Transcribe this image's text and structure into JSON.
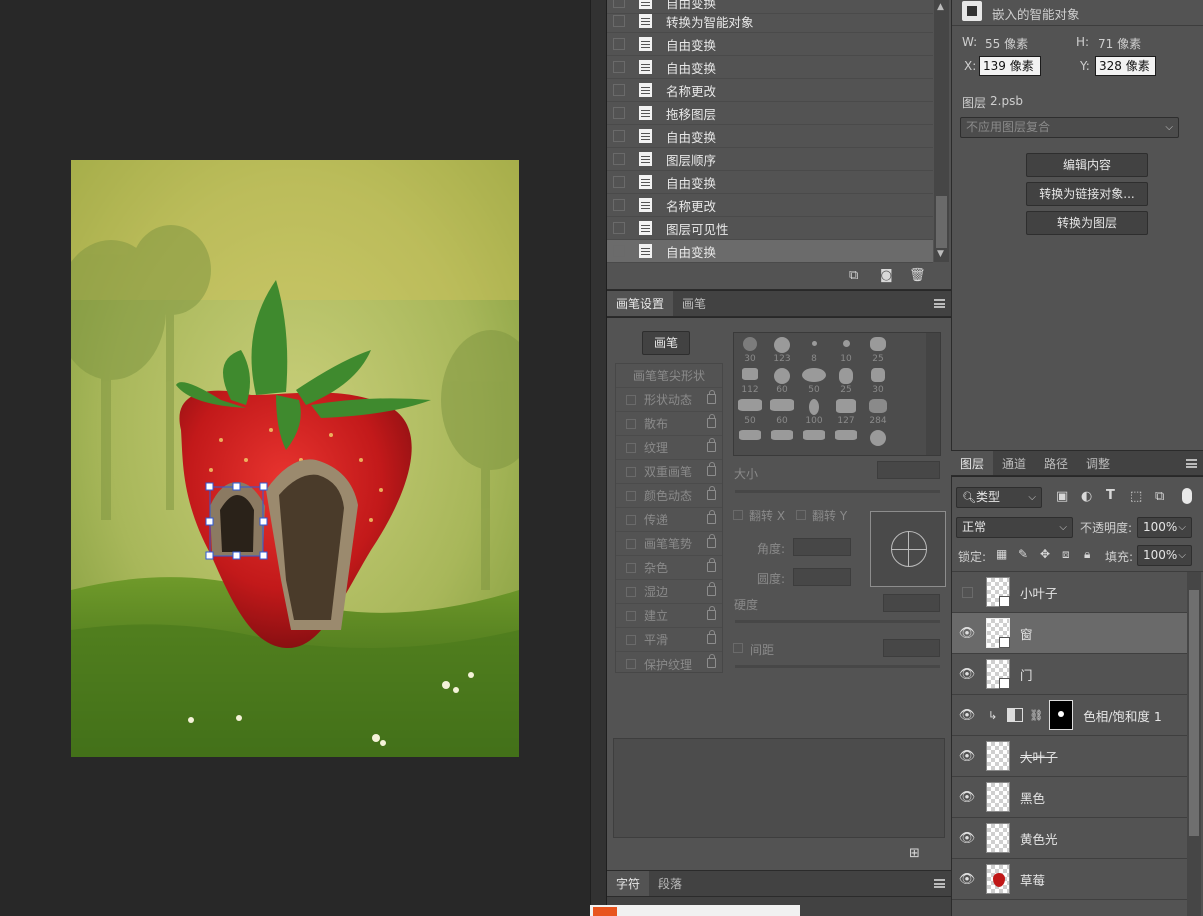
{
  "history": {
    "items": [
      {
        "label": "自由变换"
      },
      {
        "label": "转换为智能对象"
      },
      {
        "label": "自由变换"
      },
      {
        "label": "自由变换"
      },
      {
        "label": "名称更改"
      },
      {
        "label": "拖移图层"
      },
      {
        "label": "自由变换"
      },
      {
        "label": "图层顺序"
      },
      {
        "label": "自由变换"
      },
      {
        "label": "名称更改"
      },
      {
        "label": "图层可见性"
      },
      {
        "label": "自由变换"
      }
    ],
    "selected_index": 11,
    "footer_icons": [
      "new-snapshot-icon",
      "camera-icon",
      "trash-icon"
    ]
  },
  "brush_panel": {
    "tabs": [
      {
        "label": "画笔设置"
      },
      {
        "label": "画笔"
      }
    ],
    "brush_button": "画笔",
    "tip_shape_header": "画笔笔尖形状",
    "options": [
      {
        "label": "形状动态"
      },
      {
        "label": "散布"
      },
      {
        "label": "纹理"
      },
      {
        "label": "双重画笔"
      },
      {
        "label": "颜色动态"
      },
      {
        "label": "传递"
      },
      {
        "label": "画笔笔势"
      },
      {
        "label": "杂色"
      },
      {
        "label": "湿边"
      },
      {
        "label": "建立"
      },
      {
        "label": "平滑"
      },
      {
        "label": "保护纹理"
      }
    ],
    "tip_sizes": [
      "30",
      "123",
      "8",
      "10",
      "25",
      "112",
      "60",
      "50",
      "25",
      "30",
      "50",
      "60",
      "100",
      "127",
      "284",
      "",
      "",
      "",
      "",
      ""
    ],
    "size_label": "大小",
    "flip_x": "翻转 X",
    "flip_y": "翻转 Y",
    "angle_label": "角度:",
    "roundness_label": "圆度:",
    "hardness_label": "硬度",
    "spacing_label": "间距"
  },
  "char_panel": {
    "tabs": [
      {
        "label": "字符"
      },
      {
        "label": "段落"
      }
    ]
  },
  "properties": {
    "type_label": "嵌入的智能对象",
    "w_label": "W:",
    "w_value": "55 像素",
    "h_label": "H:",
    "h_value": "71 像素",
    "x_label": "X:",
    "x_value": "139 像素",
    "y_label": "Y:",
    "y_value": "328 像素",
    "source_label": "图层",
    "source_file": "2.psb",
    "comp_placeholder": "不应用图层复合",
    "edit_button": "编辑内容",
    "link_button": "转换为链接对象...",
    "layer_button": "转换为图层"
  },
  "layers_panel": {
    "tabs": [
      {
        "label": "图层"
      },
      {
        "label": "通道"
      },
      {
        "label": "路径"
      },
      {
        "label": "调整"
      }
    ],
    "filter_value": "类型",
    "blend_mode": "正常",
    "opacity_label": "不透明度:",
    "opacity_value": "100%",
    "lock_label": "锁定:",
    "fill_label": "填充:",
    "fill_value": "100%",
    "layers": [
      {
        "name": "小叶子",
        "visible": false,
        "smart": true
      },
      {
        "name": "窗",
        "visible": true,
        "smart": true
      },
      {
        "name": "门",
        "visible": true,
        "smart": true
      },
      {
        "name": "色相/饱和度 1",
        "visible": true,
        "adjustment": true
      },
      {
        "name": "大叶子",
        "visible": true
      },
      {
        "name": "黑色",
        "visible": true
      },
      {
        "name": "黄色光",
        "visible": true
      },
      {
        "name": "草莓",
        "visible": true
      }
    ],
    "selected_index": 1
  },
  "colors": {
    "panel_bg": "#535353",
    "app_bg": "#282828",
    "selection": "#6a6a6a"
  }
}
